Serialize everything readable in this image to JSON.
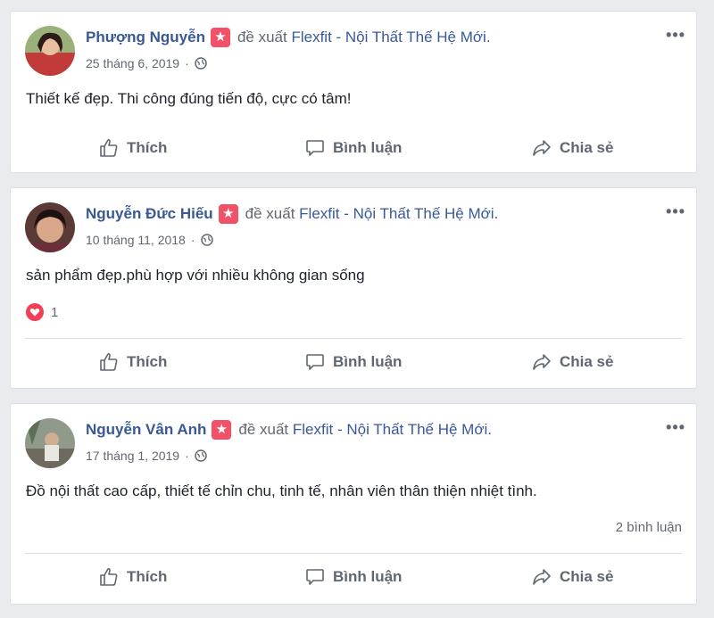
{
  "posts": [
    {
      "author": "Phượng Nguyễn",
      "recommends_text": "đề xuất",
      "page_name": "Flexfit - Nội Thất Thế Hệ Mới.",
      "date": "25 tháng 6, 2019",
      "text": "Thiết kế đẹp. Thi công đúng tiến độ, cực có tâm!",
      "reaction_count": null,
      "comment_count_text": null
    },
    {
      "author": "Nguyễn Đức Hiếu",
      "recommends_text": "đề xuất",
      "page_name": "Flexfit - Nội Thất Thế Hệ Mới.",
      "date": "10 tháng 11, 2018",
      "text": "sản phẩm đẹp.phù hợp với nhiều không gian sống",
      "reaction_count": "1",
      "comment_count_text": null
    },
    {
      "author": "Nguyễn Vân Anh",
      "recommends_text": "đề xuất",
      "page_name": "Flexfit - Nội Thất Thế Hệ Mới.",
      "date": "17 tháng 1, 2019",
      "text": "Đồ nội thất cao cấp, thiết tế chỉn chu, tinh tế, nhân viên thân thiện nhiệt tình.",
      "reaction_count": null,
      "comment_count_text": "2 bình luận"
    }
  ],
  "actions": {
    "like": "Thích",
    "comment": "Bình luận",
    "share": "Chia sẻ"
  },
  "more_label": "•••",
  "icons": {
    "like": "thumbs-up-icon",
    "comment": "comment-bubble-icon",
    "share": "share-arrow-icon",
    "privacy": "globe-icon",
    "recommend": "recommend-star-icon",
    "reaction": "heart-icon"
  },
  "colors": {
    "link": "#385898",
    "reaction_heart": "#f33e58",
    "recommend_badge": "#f25268"
  }
}
